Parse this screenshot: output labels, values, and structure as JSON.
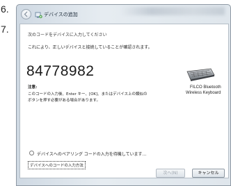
{
  "steps": {
    "six": "6.",
    "seven": "7."
  },
  "window": {
    "title": "デバイスの追加"
  },
  "content": {
    "instruction": "次のコードをデバイスに入力してください",
    "verified": "これにより、正しいデバイスと接続していることが確認されます。",
    "pairing_code": "84778982",
    "note_label": "注意:",
    "note_line1": "このコードの入力後、Enter キー、[OK]、またはデバイス上の類似の",
    "note_line2": "ボタンを押す必要がある場合があります。",
    "device_name_line1": "FILCO Bluetooth",
    "device_name_line2": "Wireless Keyboard",
    "device_icon": "keyboard-icon",
    "waiting_text": "デバイスへのペアリング コードの入力を待機しています...",
    "enter_code_link": "デバイスへのコードの入力方法"
  },
  "buttons": {
    "next": "次へ(N)",
    "cancel": "キャンセル"
  },
  "colors": {
    "titlebar": "#dfe6ec",
    "disabled_text": "#9aa2aa",
    "border": "#8d98a3"
  }
}
